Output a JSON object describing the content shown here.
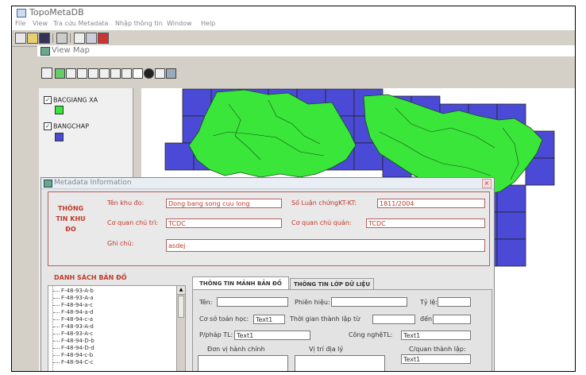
{
  "app": {
    "title": "TopoMetaDB"
  },
  "menu": [
    "File",
    "View",
    "Tra cứu Metadata",
    "Nhập thông tin",
    "Window",
    "Help"
  ],
  "view_map": {
    "title": "View Map"
  },
  "layers": [
    {
      "name": "BACGIANG XA",
      "checked": true,
      "color": "#39e639"
    },
    {
      "name": "BANGCHAP",
      "checked": true,
      "color": "#4a4ad6"
    }
  ],
  "map": {
    "polygon_fill": "#39e639",
    "grid_fill": "#4a4ad6"
  },
  "dialog": {
    "title": "Metadata Information",
    "section1_label": "THÔNG TIN KHU ĐO",
    "fields": {
      "ten_khu_do": {
        "label": "Tên khu đo:",
        "value": "Dong bang song cuu long"
      },
      "so_luan_chung": {
        "label": "Số Luận chứngKT-KT:",
        "value": "1811/2004"
      },
      "co_quan_chu_tri": {
        "label": "Cơ quan chủ trì:",
        "value": "TCDC"
      },
      "co_quan_chu_quan": {
        "label": "Cơ quan chủ quản:",
        "value": "TCDC"
      },
      "ghi_chu": {
        "label": "Ghi chú:",
        "value": "asdej"
      }
    },
    "list_title": "DANH SÁCH BẢN ĐỒ",
    "list_items": [
      "F-48-93-A-b",
      "F-48-93-A-a",
      "F-48-94-a-c",
      "F-48-94-a-d",
      "F-48-94-c-a",
      "F-48-93-A-d",
      "F-48-93-A-c",
      "F-48-94-D-b",
      "F-48-94-D-d",
      "F-48-94-c-b",
      "F-48-94-C-c"
    ],
    "tabs": [
      "THÔNG TIN MẢNH BẢN ĐỒ",
      "THÔNG TIN LỚP DỮ LIỆU"
    ],
    "panel": {
      "ten": {
        "label": "Tên:",
        "value": ""
      },
      "phien_hieu": {
        "label": "Phiên hiệu:",
        "value": ""
      },
      "ty_le": {
        "label": "Tỷ lệ:",
        "value": ""
      },
      "co_so_toan_hoc": {
        "label": "Cơ sở toán học:",
        "value": "Text1"
      },
      "thoi_gian_tu": {
        "label": "Thời gian thành lập từ",
        "value": ""
      },
      "den": {
        "label": "đến",
        "value": ""
      },
      "pp_tl": {
        "label": "P/pháp TL:",
        "value": "Text1"
      },
      "cong_nghe": {
        "label": "Công nghệTL:",
        "value": "Text1"
      },
      "don_vi": {
        "label": "Đơn vị hành chính"
      },
      "vi_tri": {
        "label": "Vị trí địa lý"
      },
      "co_quan_tl": {
        "label": "C/quan thành lập:",
        "value": "Text1"
      }
    }
  }
}
